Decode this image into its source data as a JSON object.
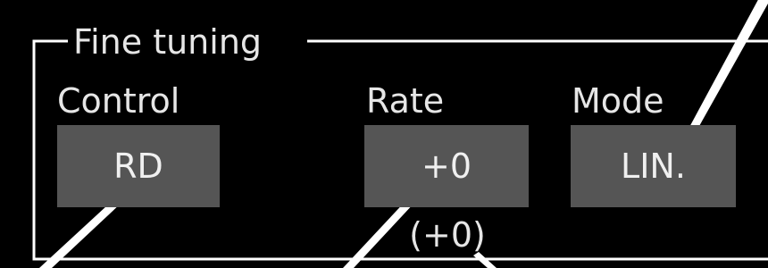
{
  "group": {
    "title": "Fine tuning"
  },
  "columns": {
    "control": {
      "label": "Control",
      "value": "RD"
    },
    "rate": {
      "label": "Rate",
      "value": "+0",
      "sub_value": "(+0)"
    },
    "mode": {
      "label": "Mode",
      "value": "LIN."
    }
  },
  "colors": {
    "background": "#000000",
    "button": "#555555",
    "text": "#e6e6e6",
    "lines": "#ffffff"
  }
}
